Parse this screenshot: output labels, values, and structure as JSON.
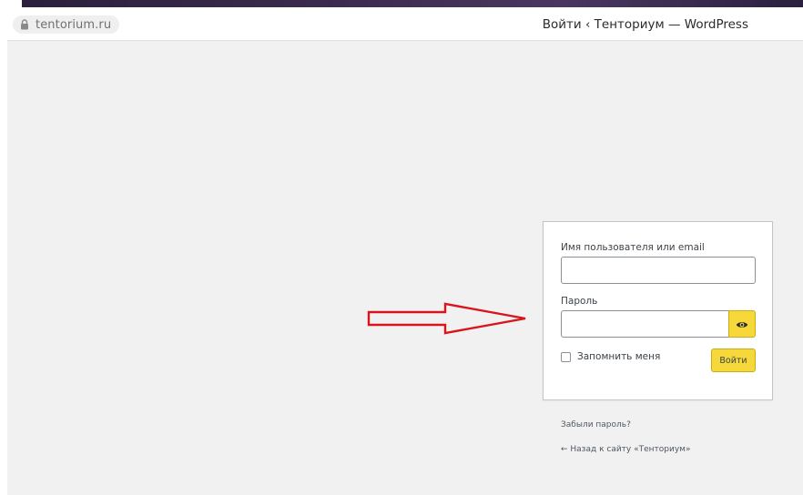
{
  "browser": {
    "url": "tentorium.ru",
    "page_title": "Войти ‹ Тенториум — WordPress"
  },
  "login": {
    "username_label": "Имя пользователя или email",
    "username_value": "",
    "password_label": "Пароль",
    "password_value": "",
    "remember_label": "Запомнить меня",
    "remember_checked": false,
    "submit_label": "Войти"
  },
  "links": {
    "lost_password": "Забыли пароль?",
    "back_to_site": "← Назад к сайту «Тенториум»"
  },
  "icons": {
    "lock": "lock-icon",
    "show_password": "eye-icon",
    "annotation": "red-arrow-icon"
  },
  "colors": {
    "page_bg": "#f1f1f1",
    "accent_yellow": "#f6d83b",
    "annotation_red": "#d9141c"
  }
}
